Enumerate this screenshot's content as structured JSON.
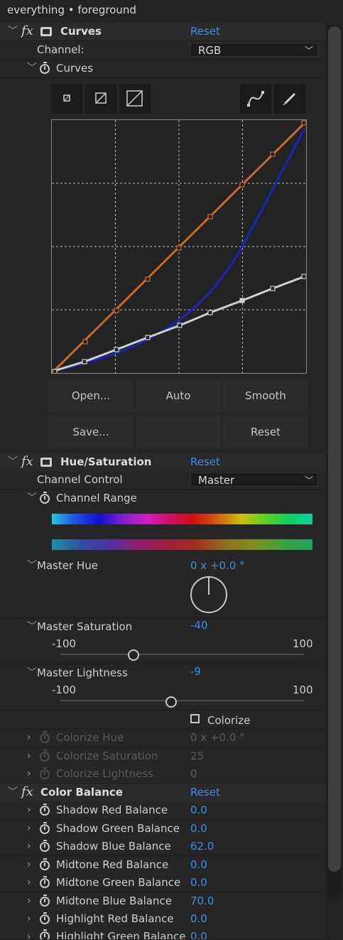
{
  "panel": {
    "title": "everything • foreground"
  },
  "curves": {
    "effect_name": "Curves",
    "reset": "Reset",
    "channel_label": "Channel:",
    "channel_value": "RGB",
    "curves_label": "Curves",
    "tools": [
      "curve-tool-small-icon",
      "curve-tool-medium-icon",
      "curve-tool-large-icon",
      "bezier-pen-icon",
      "pencil-icon"
    ],
    "buttons": {
      "open": "Open...",
      "auto": "Auto",
      "smooth": "Smooth",
      "save": "Save...",
      "reset": "Reset"
    },
    "colors": {
      "orange": "#c86a28",
      "blue": "#1a24b8",
      "white": "#d0d0d0"
    }
  },
  "hue_saturation": {
    "effect_name": "Hue/Saturation",
    "reset": "Reset",
    "channel_control_label": "Channel Control",
    "channel_control_value": "Master",
    "channel_range_label": "Channel Range",
    "master_hue_label": "Master Hue",
    "master_hue_value": "0 x +0.0 °",
    "master_saturation_label": "Master Saturation",
    "master_saturation_value": "-40",
    "master_saturation_min": "-100",
    "master_saturation_max": "100",
    "master_lightness_label": "Master Lightness",
    "master_lightness_value": "-9",
    "master_lightness_min": "-100",
    "master_lightness_max": "100",
    "colorize_label": "Colorize",
    "colorize_hue_label": "Colorize Hue",
    "colorize_hue_value": "0 x +0.0 °",
    "colorize_saturation_label": "Colorize Saturation",
    "colorize_saturation_value": "25",
    "colorize_lightness_label": "Colorize Lightness",
    "colorize_lightness_value": "0"
  },
  "color_balance": {
    "effect_name": "Color Balance",
    "reset": "Reset",
    "params": [
      {
        "label": "Shadow Red Balance",
        "value": "0.0"
      },
      {
        "label": "Shadow Green Balance",
        "value": "0.0"
      },
      {
        "label": "Shadow Blue Balance",
        "value": "62.0"
      },
      {
        "label": "Midtone Red Balance",
        "value": "0.0"
      },
      {
        "label": "Midtone Green Balance",
        "value": "0.0"
      },
      {
        "label": "Midtone Blue Balance",
        "value": "70.0"
      },
      {
        "label": "Highlight Red Balance",
        "value": "0.0"
      },
      {
        "label": "Highlight Green Balance",
        "value": "0.0"
      }
    ]
  }
}
